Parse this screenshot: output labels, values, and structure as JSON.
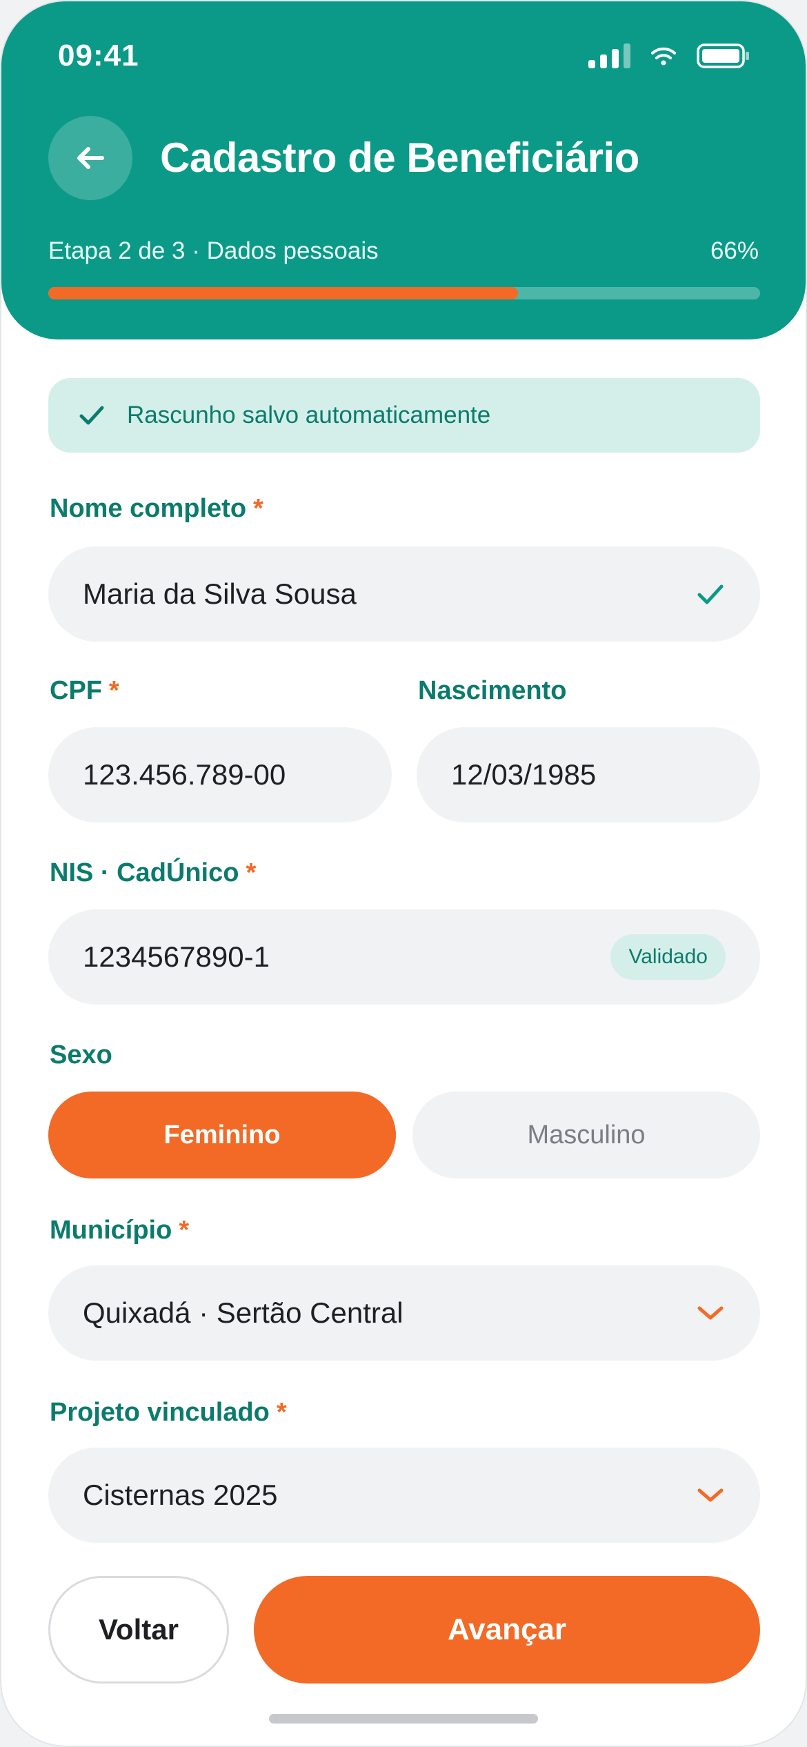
{
  "status_bar": {
    "time": "09:41"
  },
  "header": {
    "title": "Cadastro de Beneficiário",
    "step_label": "Etapa 2 de 3 · Dados pessoais",
    "progress_text": "66%",
    "progress_value": 0.66
  },
  "autosave": {
    "text": "Rascunho salvo automaticamente"
  },
  "form": {
    "name": {
      "label": "Nome completo",
      "required_mark": "*",
      "value": "Maria da Silva Sousa"
    },
    "cpf": {
      "label": "CPF",
      "required_mark": "*",
      "value": "123.456.789-00"
    },
    "birth": {
      "label": "Nascimento",
      "value": "12/03/1985"
    },
    "nis": {
      "label": "NIS · CadÚnico",
      "required_mark": "*",
      "value": "1234567890-1",
      "badge": "Validado"
    },
    "sex": {
      "label": "Sexo",
      "options": [
        "Feminino",
        "Masculino"
      ],
      "selected": "Feminino"
    },
    "city": {
      "label": "Município",
      "required_mark": "*",
      "value": "Quixadá · Sertão Central"
    },
    "project": {
      "label": "Projeto vinculado",
      "required_mark": "*",
      "value": "Cisternas 2025"
    }
  },
  "actions": {
    "back": "Voltar",
    "next": "Avançar"
  },
  "colors": {
    "primary": "#0b9a88",
    "accent": "#f26a25",
    "label": "#0b7b6c",
    "field_bg": "#f1f2f4",
    "success_bg": "#d4efe9"
  },
  "icons": {
    "back": "arrow-left-icon",
    "autosave": "check-icon",
    "name_valid": "check-icon",
    "dropdown": "chevron-down-icon"
  }
}
